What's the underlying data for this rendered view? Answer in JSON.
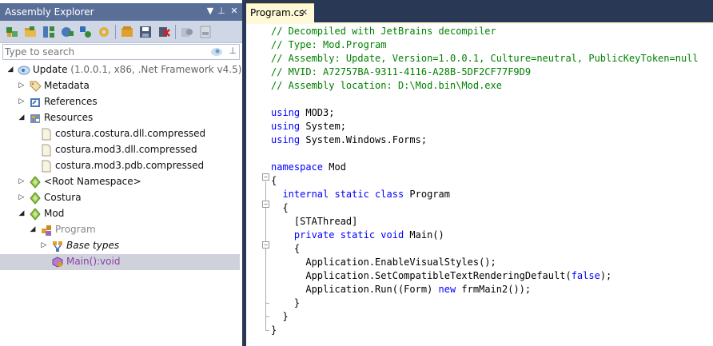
{
  "left_pane": {
    "title": "Assembly Explorer",
    "controls": {
      "dropdown": "▼",
      "pin": "⊥",
      "close": "✕"
    },
    "search": {
      "placeholder": "Type to search",
      "value": ""
    },
    "toolbar_icons": [
      "open-assembly-icon",
      "open-folder-icon",
      "assembly-list-icon",
      "refresh-icon",
      "nuget-icon",
      "settings-icon",
      "save-icon",
      "export-icon",
      "remove-icon",
      "decompile-icon",
      "pdb-icon"
    ],
    "tree": [
      {
        "id": "update",
        "label": "Update",
        "detail": " (1.0.0.1, x86, .Net Framework v4.5)",
        "icon": "assembly-icon",
        "expander": "expanded"
      },
      {
        "id": "metadata",
        "label": "Metadata",
        "icon": "metadata-tag-icon",
        "expander": "collapsed"
      },
      {
        "id": "references",
        "label": "References",
        "icon": "references-icon",
        "expander": "collapsed"
      },
      {
        "id": "resources",
        "label": "Resources",
        "icon": "resources-icon",
        "expander": "expanded"
      },
      {
        "id": "res1",
        "label": "costura.costura.dll.compressed",
        "icon": "file-icon"
      },
      {
        "id": "res2",
        "label": "costura.mod3.dll.compressed",
        "icon": "file-icon"
      },
      {
        "id": "res3",
        "label": "costura.mod3.pdb.compressed",
        "icon": "file-icon"
      },
      {
        "id": "rootns",
        "label": "<Root Namespace>",
        "icon": "namespace-icon",
        "expander": "collapsed"
      },
      {
        "id": "costura",
        "label": "Costura",
        "icon": "namespace-icon",
        "expander": "collapsed"
      },
      {
        "id": "mod",
        "label": "Mod",
        "icon": "namespace-icon",
        "expander": "expanded"
      },
      {
        "id": "program",
        "label": "Program",
        "icon": "class-icon",
        "expander": "expanded"
      },
      {
        "id": "basetypes",
        "label": "Base types",
        "icon": "base-types-icon",
        "expander": "collapsed"
      },
      {
        "id": "main",
        "label": "Main():void",
        "icon": "method-icon",
        "selected": true
      }
    ]
  },
  "editor": {
    "tab_label": "Program.cs",
    "tab_close": "✕",
    "code_lines": [
      [
        {
          "t": "// Decompiled with JetBrains decompiler",
          "c": "cm"
        }
      ],
      [
        {
          "t": "// Type: Mod.Program",
          "c": "cm"
        }
      ],
      [
        {
          "t": "// Assembly: Update, Version=1.0.0.1, Culture=neutral, PublicKeyToken=null",
          "c": "cm"
        }
      ],
      [
        {
          "t": "// MVID: A72757BA-9311-4116-A28B-5DF2CF77F9D9",
          "c": "cm"
        }
      ],
      [
        {
          "t": "// Assembly location: D:\\Mod.bin\\Mod.exe",
          "c": "cm"
        }
      ],
      [],
      [
        {
          "t": "using",
          "c": "kw"
        },
        {
          "t": " MOD3;"
        }
      ],
      [
        {
          "t": "using",
          "c": "kw"
        },
        {
          "t": " System;"
        }
      ],
      [
        {
          "t": "using",
          "c": "kw"
        },
        {
          "t": " System.Windows.Forms;"
        }
      ],
      [],
      [
        {
          "t": "namespace",
          "c": "kw"
        },
        {
          "t": " Mod"
        }
      ],
      [
        {
          "t": "{"
        }
      ],
      [
        {
          "t": "  "
        },
        {
          "t": "internal static class",
          "c": "kw"
        },
        {
          "t": " Program"
        }
      ],
      [
        {
          "t": "  {"
        }
      ],
      [
        {
          "t": "    [STAThread]"
        }
      ],
      [
        {
          "t": "    "
        },
        {
          "t": "private static void",
          "c": "kw"
        },
        {
          "t": " Main()"
        }
      ],
      [
        {
          "t": "    {"
        }
      ],
      [
        {
          "t": "      Application.EnableVisualStyles();"
        }
      ],
      [
        {
          "t": "      Application.SetCompatibleTextRenderingDefault("
        },
        {
          "t": "false",
          "c": "kw"
        },
        {
          "t": ");"
        }
      ],
      [
        {
          "t": "      Application.Run((Form) "
        },
        {
          "t": "new",
          "c": "kw"
        },
        {
          "t": " frmMain2());"
        }
      ],
      [
        {
          "t": "    }"
        }
      ],
      [
        {
          "t": "  }"
        }
      ],
      [
        {
          "t": "}"
        }
      ]
    ]
  },
  "colors": {
    "chrome": "#293955",
    "panel_title": "#5a6f98",
    "selection": "#cfd2db",
    "tab": "#fff9d8",
    "comment": "#008000",
    "keyword": "#0000ff",
    "method": "#8b3fa8"
  }
}
